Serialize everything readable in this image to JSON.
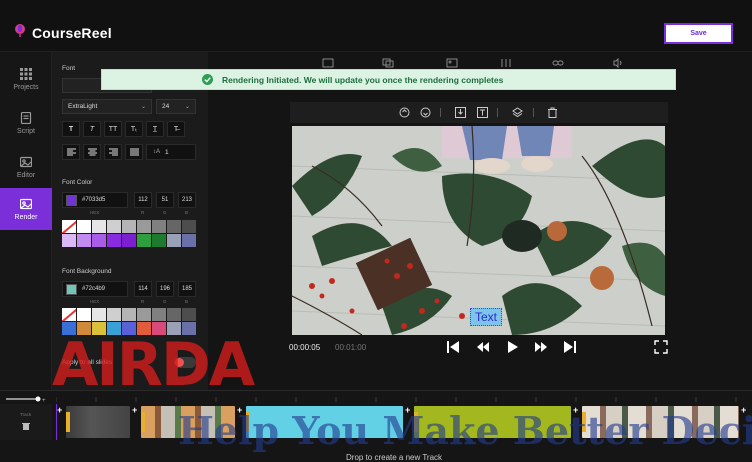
{
  "app": {
    "name": "CourseReel",
    "save_label": "Save"
  },
  "nav": [
    {
      "label": "Projects",
      "icon": "grid-icon"
    },
    {
      "label": "Script",
      "icon": "document-icon"
    },
    {
      "label": "Editor",
      "icon": "image-icon"
    },
    {
      "label": "Render",
      "icon": "render-icon",
      "active": true
    }
  ],
  "panel": {
    "font_label": "Font",
    "font_weight": "ExtraLight",
    "font_size": "24",
    "line_height": "1",
    "format_buttons": [
      "T",
      "T",
      "TT",
      "Tₜ",
      "T̲",
      "T̶"
    ],
    "font_color_label": "Font Color",
    "font_color": {
      "hex": "#7033d5",
      "r": "112",
      "g": "51",
      "b": "213",
      "swatch": "#7033d5"
    },
    "font_bg_label": "Font Background",
    "font_bg": {
      "hex": "#72c4b9",
      "r": "114",
      "g": "196",
      "b": "185",
      "swatch": "#72c4b9"
    },
    "channel_labels": [
      "HEX",
      "R",
      "G",
      "B"
    ],
    "apply_all_label": "Apply to all slides",
    "apply_all_on": false,
    "palette_color": [
      "none",
      "#ffffff",
      "#e6e6e6",
      "#cfcfcf",
      "#b5b5b5",
      "#9a9a9a",
      "#808080",
      "#666666",
      "#4d4d4d",
      "#d9b8f5",
      "#c38bf0",
      "#a85ce8",
      "#8a2be2",
      "#7c1fd1",
      "#2e9f3e",
      "#1e7a2e",
      "#9aa0b5",
      "#6a70a8"
    ],
    "palette_bg": [
      "none",
      "#ffffff",
      "#e6e6e6",
      "#cfcfcf",
      "#b5b5b5",
      "#9a9a9a",
      "#808080",
      "#666666",
      "#4d4d4d",
      "#3a6fd8",
      "#d08a3a",
      "#d9c23a",
      "#3aa0d8",
      "#5a60d8",
      "#e25b3a",
      "#d84a7a",
      "#9aa0b5",
      "#6a70a8"
    ]
  },
  "toast": {
    "message": "Rendering Initiated. We will update you once the rendering completes"
  },
  "preview": {
    "caption": "Text",
    "current_time": "00:00:05",
    "total_time": "00:01:00"
  },
  "timeline": {
    "drop_hint": "Drop to create a new Track",
    "track_label": "Track"
  },
  "watermark": {
    "primary": "AIRDA",
    "secondary": "Help You Make Better Deci"
  },
  "colors": {
    "accent": "#7b2fd8",
    "toast_bg": "#dcf3e4",
    "toast_text": "#1f6e3d"
  }
}
